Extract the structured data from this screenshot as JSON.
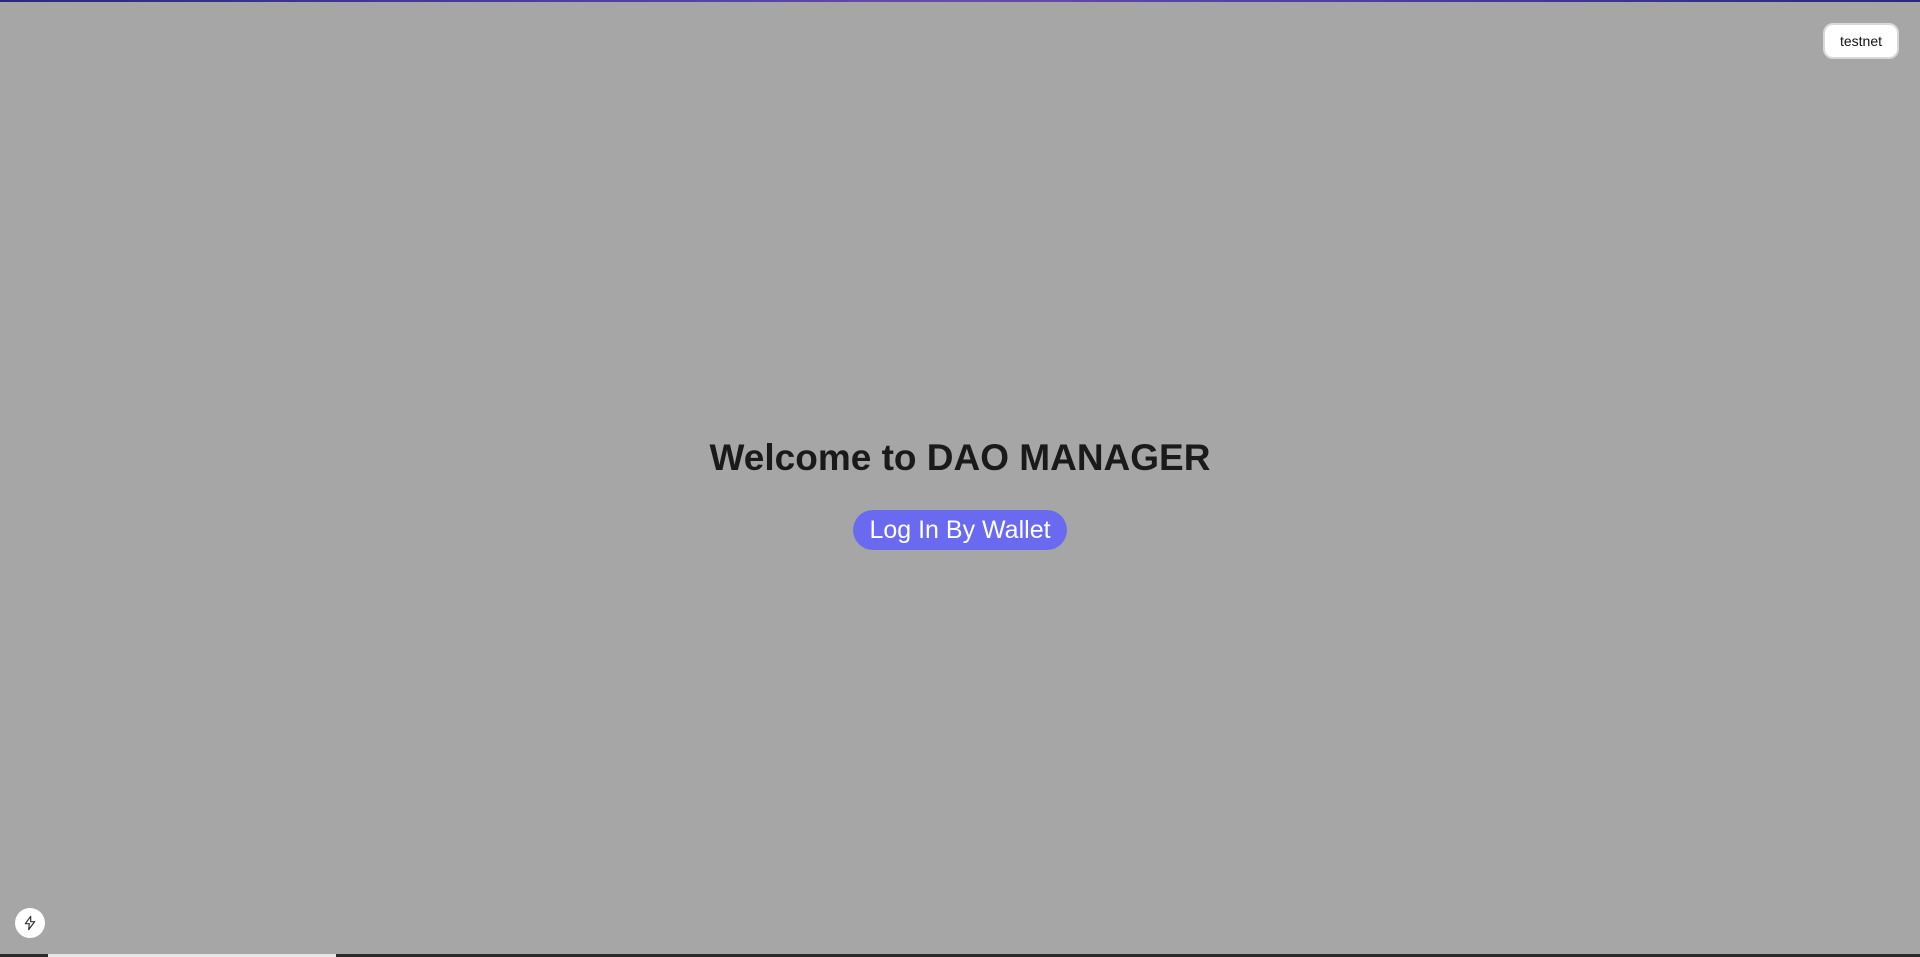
{
  "network_selector": {
    "label": "testnet"
  },
  "main": {
    "title": "Welcome to DAO MANAGER",
    "login_button_label": "Log In By Wallet"
  },
  "dev_tools": {
    "icon": "lightning-bolt-icon"
  },
  "colors": {
    "background": "#a6a6a6",
    "accent": "#6a6af0",
    "title_text": "#1a1a1a"
  }
}
